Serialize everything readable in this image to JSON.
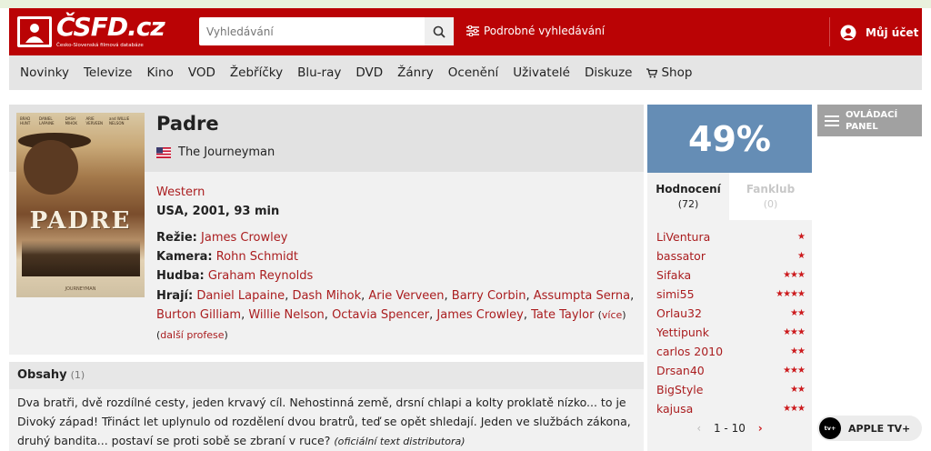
{
  "header": {
    "logo_text": "ČSFD.cz",
    "logo_subtitle": "Česko-Slovenská filmová databáze",
    "search_placeholder": "Vyhledávání",
    "advanced_search": "Podrobné vyhledávání",
    "account": "Můj účet"
  },
  "nav": {
    "items": [
      "Novinky",
      "Televize",
      "Kino",
      "VOD",
      "Žebříčky",
      "Blu-ray",
      "DVD",
      "Žánry",
      "Ocenění",
      "Uživatelé",
      "Diskuze",
      "Shop"
    ]
  },
  "film": {
    "title": "Padre",
    "original_title": "The Journeyman",
    "genre": "Western",
    "origin": "USA, 2001, 93 min",
    "director_label": "Režie:",
    "director": "James Crowley",
    "camera_label": "Kamera:",
    "camera": "Rohn Schmidt",
    "music_label": "Hudba:",
    "music": "Graham Reynolds",
    "cast_label": "Hrají:",
    "cast": [
      "Daniel Lapaine",
      "Dash Mihok",
      "Arie Verveen",
      "Barry Corbin",
      "Assumpta Serna",
      "Burton Gilliam",
      "Willie Nelson",
      "Octavia Spencer",
      "James Crowley",
      "Tate Taylor"
    ],
    "more_label": "více",
    "more_professions": "další profese",
    "poster_title": "PADRE",
    "poster_subtitle": "JOURNEYMAN",
    "poster_names": [
      "BRAD HUNT",
      "DANIEL LAPAINE",
      "DASH MIHOK",
      "ARIE VERVEEN",
      "and WILLIE NELSON"
    ]
  },
  "plot": {
    "title": "Obsahy",
    "count": "(1)",
    "line1": "Dva bratři, dvě rozdílné cesty, jeden krvavý cíl. Nehostinná země, drsní chlapi a kolty proklatě nízko... to je",
    "line2": "Divoký západ! Třináct let uplynulo od rozdělení dvou bratrů, teď se opět shledají. Jeden ve službách zákona,",
    "line3": "druhý bandita... postaví se proti sobě se zbraní v ruce?",
    "source": "(oficiální text distributora)"
  },
  "rating": {
    "score": "49%",
    "accent_color": "#658db5",
    "tab_ratings": "Hodnocení",
    "tab_ratings_count": "(72)",
    "tab_fanclub": "Fanklub",
    "tab_fanclub_count": "(0)",
    "users": [
      {
        "name": "LiVentura",
        "stars": "★"
      },
      {
        "name": "bassator",
        "stars": "★"
      },
      {
        "name": "Sifaka",
        "stars": "★★★"
      },
      {
        "name": "simi55",
        "stars": "★★★★"
      },
      {
        "name": "Orlau32",
        "stars": "★★"
      },
      {
        "name": "Yettipunk",
        "stars": "★★★"
      },
      {
        "name": "carlos 2010",
        "stars": "★★"
      },
      {
        "name": "Drsan40",
        "stars": "★★★"
      },
      {
        "name": "BigStyle",
        "stars": "★★"
      },
      {
        "name": "kajusa",
        "stars": "★★★"
      }
    ],
    "pager": "1 - 10"
  },
  "side": {
    "control_panel_line1": "OVLÁDACÍ",
    "control_panel_line2": "PANEL",
    "appletv_label": "APPLE TV+",
    "appletv_badge": "tv+"
  }
}
